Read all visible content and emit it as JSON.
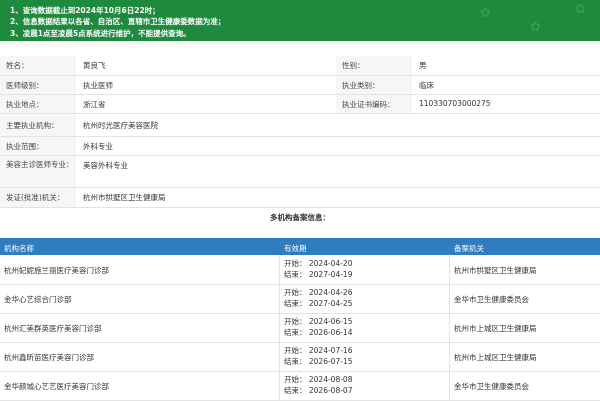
{
  "notice": {
    "lines": [
      "1、查询数据截止到2024年10月6日22时；",
      "2、信息数据结果以各省、自治区、直辖市卫生健康委数据为准；",
      "3、凌晨1点至凌晨5点系统进行维护，不能提供查询。"
    ]
  },
  "info": {
    "name_label": "姓名：",
    "name_value": "黄良飞",
    "gender_label": "性别：",
    "gender_value": "男",
    "level_label": "医师级别：",
    "level_value": "执业医师",
    "category_label": "执业类别：",
    "category_value": "临床",
    "location_label": "执业地点：",
    "location_value": "浙江省",
    "cert_label": "执业证书编码：",
    "cert_value": "110330703000275",
    "org_label": "主要执业机构：",
    "org_value": "杭州时光医疗美容医院",
    "scope_label": "执业范围：",
    "scope_value": "外科专业",
    "specialty_label": "美容主诊医师专业：",
    "specialty_value": "美容外科专业",
    "issuer_label": "发证(批准)机关：",
    "issuer_value": "杭州市拱墅区卫生健康局"
  },
  "multi": {
    "title": "多机构备案信息：",
    "headers": {
      "name": "机构名称",
      "period": "有效期",
      "authority": "备案机关"
    },
    "rows": [
      {
        "name": "杭州妃妮施兰丽医疗美容门诊部",
        "start": "开始：  2024-04-20",
        "end": "结束：  2027-04-19",
        "authority": "杭州市拱墅区卫生健康局"
      },
      {
        "name": "金华心艺综合门诊部",
        "start": "开始：  2024-04-26",
        "end": "结束：  2027-04-25",
        "authority": "金华市卫生健康委员会"
      },
      {
        "name": "杭州汇美群英医疗美容门诊部",
        "start": "开始：  2024-06-15",
        "end": "结束：  2026-06-14",
        "authority": "杭州市上城区卫生健康局"
      },
      {
        "name": "杭州鑫昕苗医疗美容门诊部",
        "start": "开始：  2024-07-16",
        "end": "结束：  2026-07-15",
        "authority": "杭州市上城区卫生健康局"
      },
      {
        "name": "金华颜城心艺艺医疗美容门诊部",
        "start": "开始：  2024-08-08",
        "end": "结束：  2026-08-07",
        "authority": "金华市卫生健康委员会"
      }
    ]
  }
}
